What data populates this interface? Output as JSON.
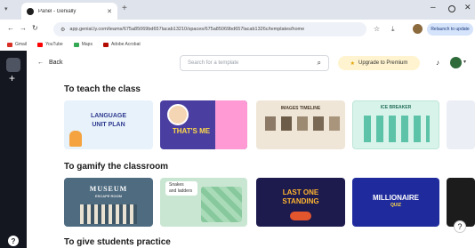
{
  "browser": {
    "tab_title": "Panel - Genially",
    "url": "app.genial.ly.com/teams/675a85069bd657lacab13210/spaces/675a85069bd657lacab1326c/templates/home",
    "update_label": "Relaunch to update",
    "bookmarks": [
      {
        "label": "Gmail",
        "color": "#d93025"
      },
      {
        "label": "YouTube",
        "color": "#ff0000"
      },
      {
        "label": "Maps",
        "color": "#34a853"
      },
      {
        "label": "Adobe Acrobat",
        "color": "#b30b00"
      }
    ]
  },
  "app": {
    "back_label": "Back",
    "search": {
      "placeholder": "Search for a template"
    },
    "premium_label": "Upgrade to Premium",
    "help_label": "?"
  },
  "sections": [
    {
      "title": "To teach the class",
      "cards": [
        {
          "line1": "LANGUAGE",
          "line2": "UNIT PLAN"
        },
        {
          "line1": "THAT'S ME"
        },
        {
          "line1": "IMAGES TIMELINE"
        },
        {
          "line1": "ICE BREAKER"
        }
      ]
    },
    {
      "title": "To gamify the classroom",
      "cards": [
        {
          "line1": "MUSEUM",
          "line2": "ESCAPE ROOM"
        },
        {
          "line1": "Snakes",
          "line2": "and ladders"
        },
        {
          "line1": "LAST ONE",
          "line2": "STANDING"
        },
        {
          "line1": "MILLIONAIRE",
          "line2": "QUIZ"
        }
      ]
    },
    {
      "title": "To give students practice"
    }
  ]
}
